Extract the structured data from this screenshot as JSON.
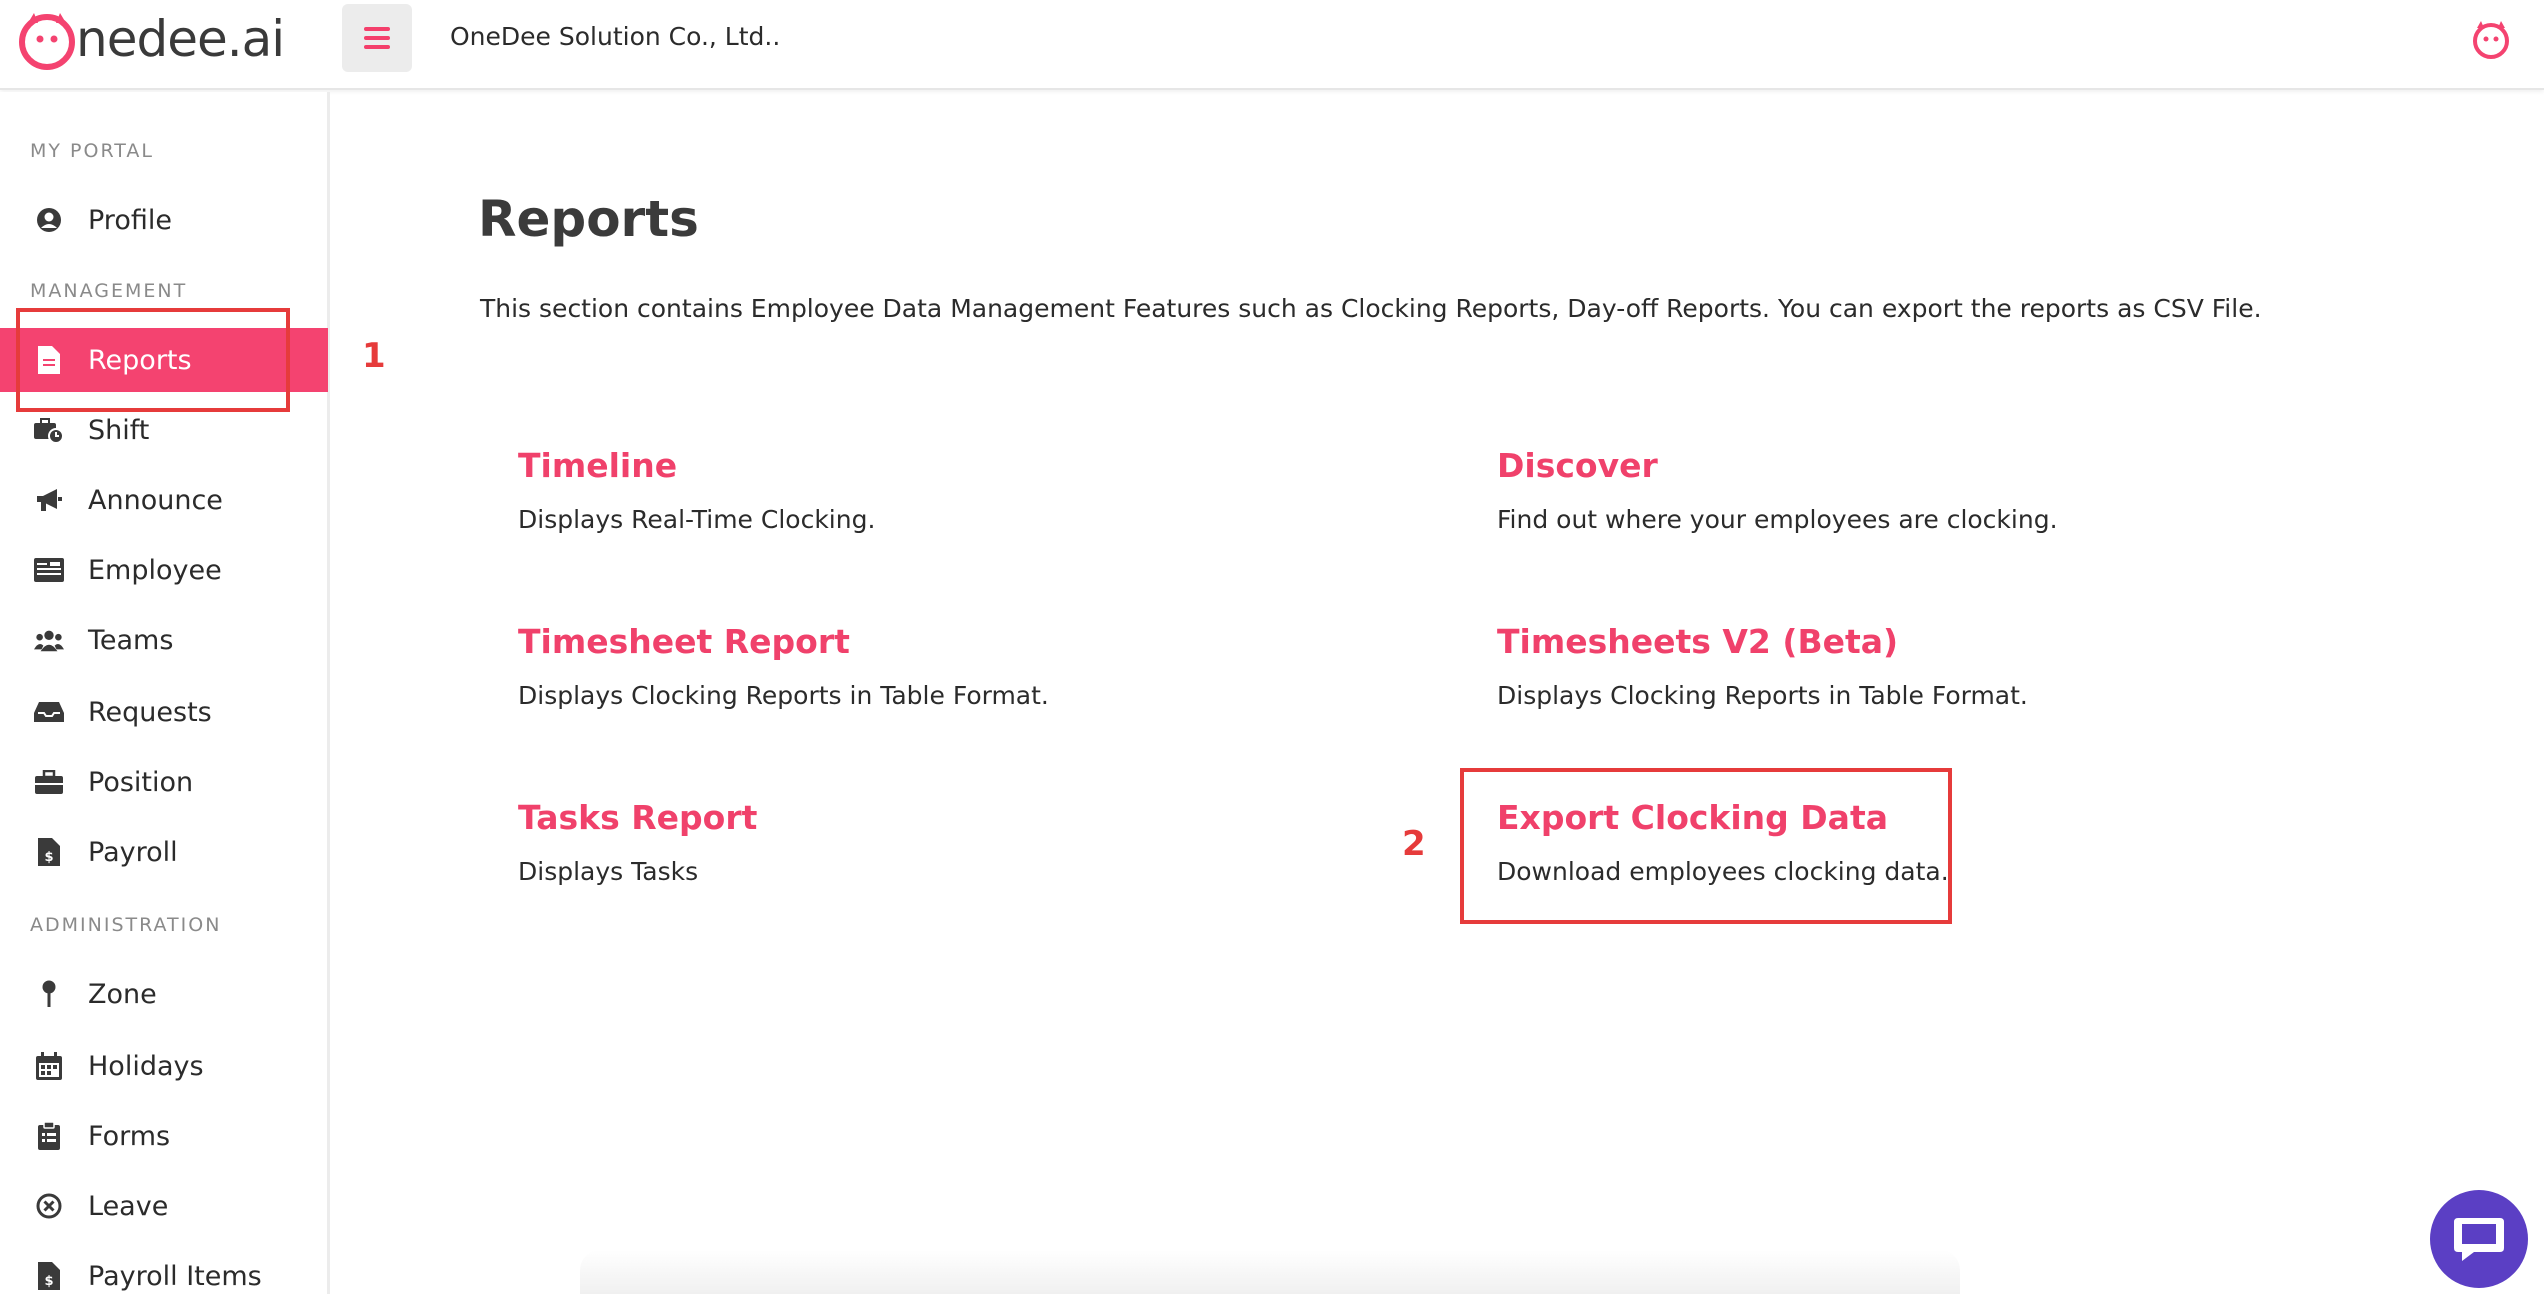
{
  "header": {
    "logo_text": "nedee.ai",
    "company": "OneDee Solution Co., Ltd.."
  },
  "colors": {
    "accent": "#f44370",
    "annotation": "#e63b3b",
    "chat": "#5b3fc4"
  },
  "sidebar": {
    "sections": {
      "portal": "MY PORTAL",
      "management": "MANAGEMENT",
      "administration": "ADMINISTRATION"
    },
    "items": [
      {
        "label": "Profile",
        "icon": "user-circle-icon"
      },
      {
        "label": "Reports",
        "icon": "file-icon",
        "active": true
      },
      {
        "label": "Shift",
        "icon": "briefcase-clock-icon"
      },
      {
        "label": "Announce",
        "icon": "megaphone-icon"
      },
      {
        "label": "Employee",
        "icon": "id-card-icon"
      },
      {
        "label": "Teams",
        "icon": "users-icon"
      },
      {
        "label": "Requests",
        "icon": "inbox-icon"
      },
      {
        "label": "Position",
        "icon": "briefcase-icon"
      },
      {
        "label": "Payroll",
        "icon": "invoice-dollar-icon"
      },
      {
        "label": "Zone",
        "icon": "pin-icon"
      },
      {
        "label": "Holidays",
        "icon": "calendar-icon"
      },
      {
        "label": "Forms",
        "icon": "clipboard-icon"
      },
      {
        "label": "Leave",
        "icon": "x-circle-icon"
      },
      {
        "label": "Payroll Items",
        "icon": "invoice-dollar-icon"
      }
    ]
  },
  "annotations": {
    "step1": "1",
    "step2": "2"
  },
  "main": {
    "title": "Reports",
    "description": "This section contains Employee Data Management Features such as Clocking Reports, Day-off Reports. You can export the reports as CSV File.",
    "cards": [
      {
        "title": "Timeline",
        "desc": "Displays Real-Time Clocking."
      },
      {
        "title": "Discover",
        "desc": "Find out where your employees are clocking."
      },
      {
        "title": "Timesheet Report",
        "desc": "Displays Clocking Reports in Table Format."
      },
      {
        "title": "Timesheets V2 (Beta)",
        "desc": "Displays Clocking Reports in Table Format."
      },
      {
        "title": "Tasks Report",
        "desc": "Displays Tasks"
      },
      {
        "title": "Export Clocking Data",
        "desc": "Download employees clocking data."
      }
    ]
  }
}
